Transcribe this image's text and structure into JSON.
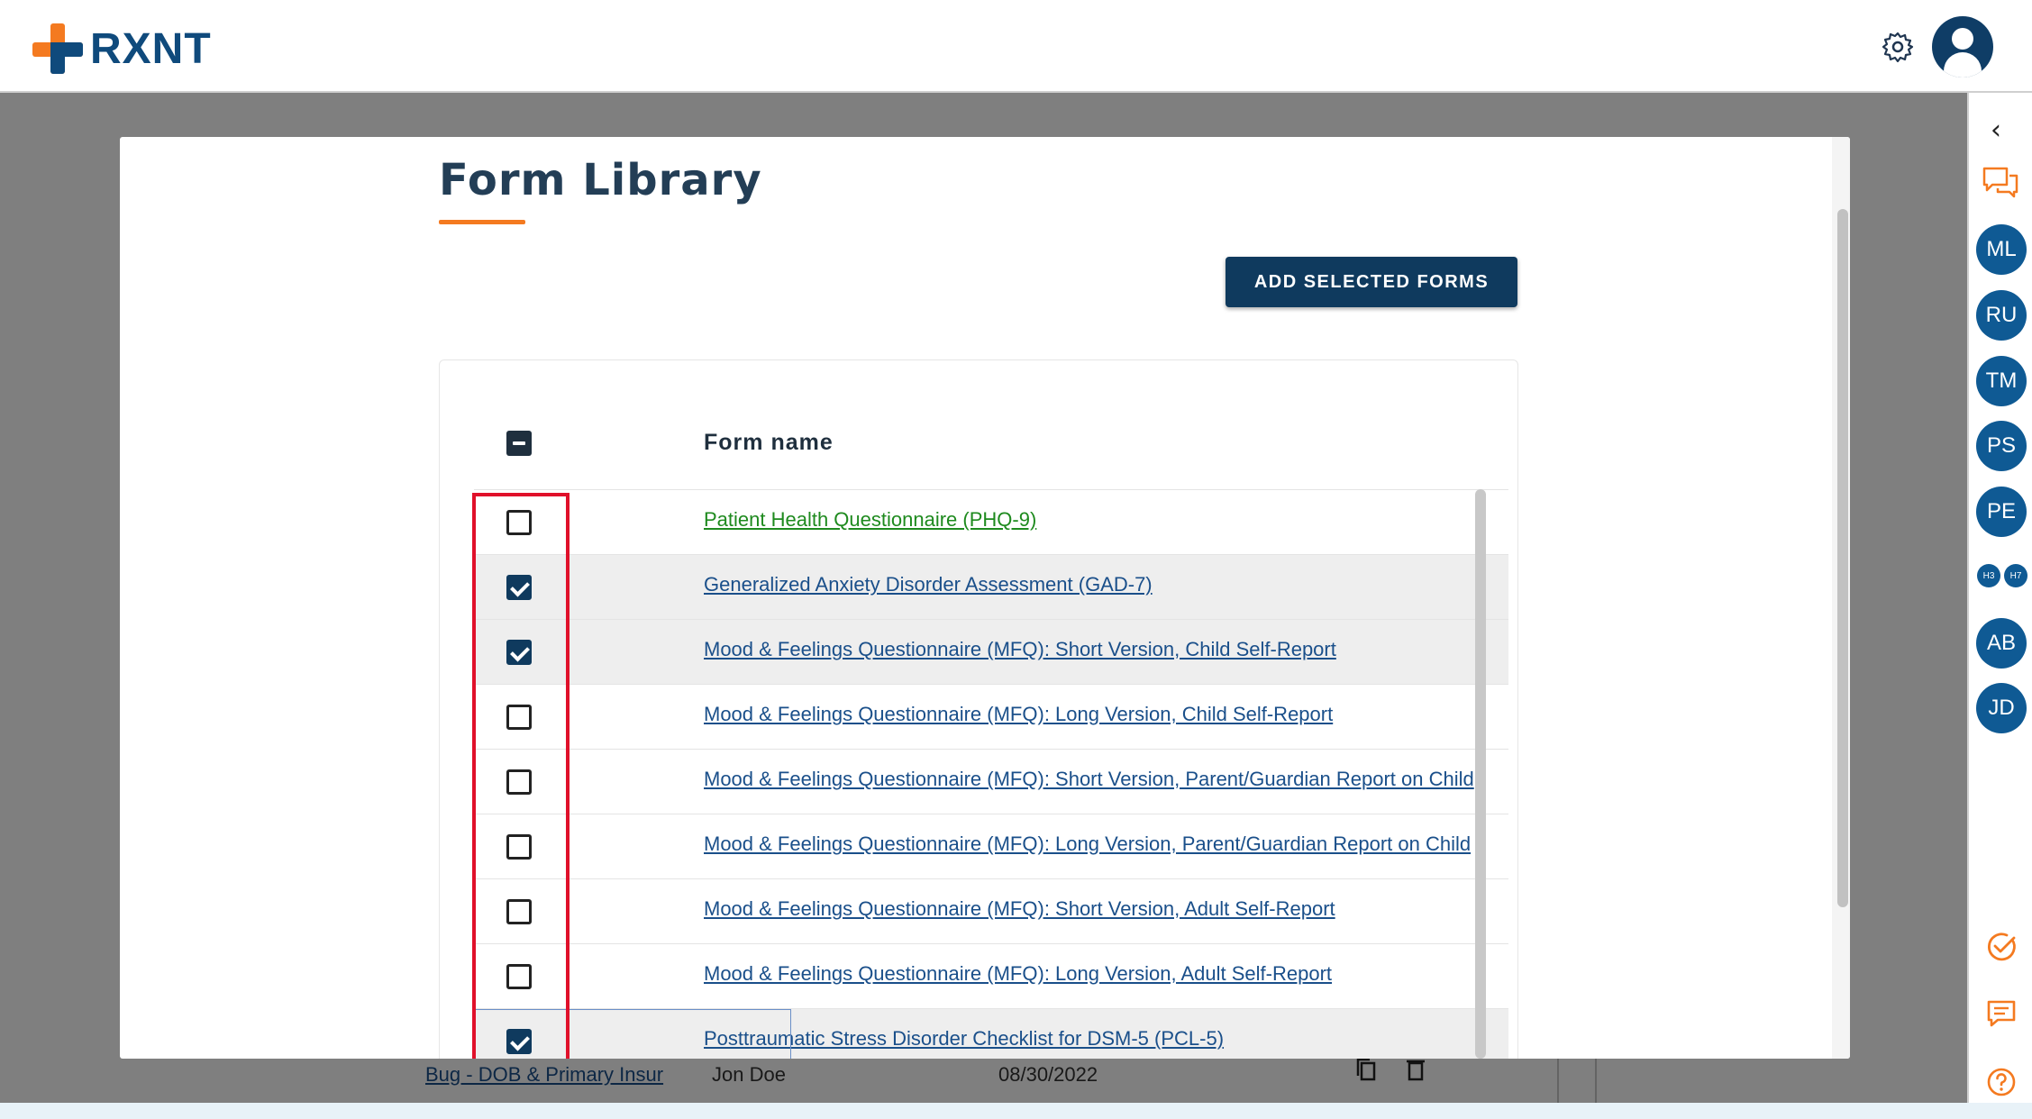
{
  "app": {
    "logo_text": "RXNT",
    "brand_colors": {
      "orange": "#f47a20",
      "navy": "#0f4a7c"
    }
  },
  "header": {
    "settings_icon": "gear-icon",
    "avatar_icon": "user-avatar-icon"
  },
  "background": {
    "row_link": "Bug - DOB & Primary Insur",
    "row_patient": "Jon Doe",
    "row_date": "08/30/2022"
  },
  "rail": {
    "collapse_icon": "chevron-left-icon",
    "chat_icon": "chat-bubbles-icon",
    "avatars": [
      "ML",
      "RU",
      "TM",
      "PS",
      "PE"
    ],
    "mini_avatars": [
      "H3",
      "H7"
    ],
    "avatars_bottom": [
      "AB",
      "JD"
    ],
    "tasks_icon": "check-circle-icon",
    "messages_icon": "message-icon",
    "help_icon": "help-icon"
  },
  "modal": {
    "title": "Form Library",
    "add_button": "ADD SELECTED FORMS",
    "column_header": "Form name",
    "forms": [
      {
        "name": "Patient Health Questionnaire (PHQ-9)",
        "checked": false,
        "color": "green"
      },
      {
        "name": "Generalized Anxiety Disorder Assessment (GAD-7)",
        "checked": true
      },
      {
        "name": "Mood & Feelings Questionnaire (MFQ): Short Version, Child Self-Report",
        "checked": true
      },
      {
        "name": "Mood & Feelings Questionnaire (MFQ): Long Version, Child Self-Report",
        "checked": false
      },
      {
        "name": "Mood & Feelings Questionnaire (MFQ): Short Version, Parent/Guardian Report on Child",
        "checked": false
      },
      {
        "name": "Mood & Feelings Questionnaire (MFQ): Long Version, Parent/Guardian Report on Child",
        "checked": false
      },
      {
        "name": "Mood & Feelings Questionnaire (MFQ): Short Version, Adult Self-Report",
        "checked": false
      },
      {
        "name": "Mood & Feelings Questionnaire (MFQ): Long Version, Adult Self-Report",
        "checked": false
      },
      {
        "name": "Posttraumatic Stress Disorder Checklist for DSM-5 (PCL-5)",
        "checked": true
      }
    ]
  }
}
